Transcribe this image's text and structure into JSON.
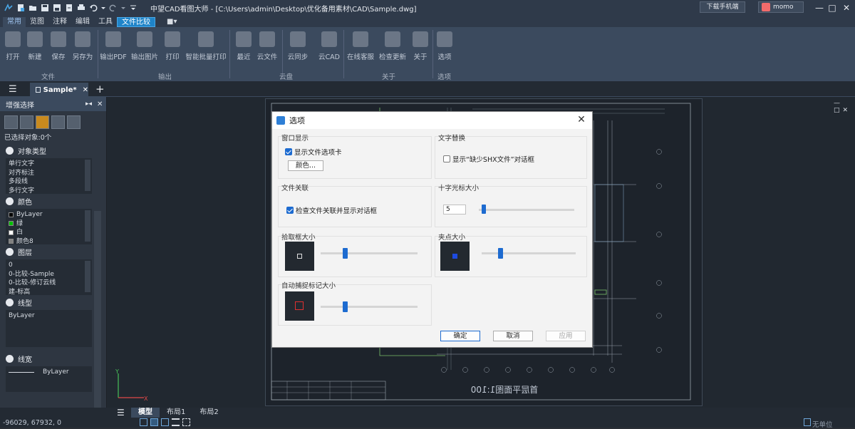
{
  "app": {
    "title": "中望CAD看图大师 - [C:\\Users\\admin\\Desktop\\优化备用素材\\CAD\\Sample.dwg]",
    "download_mobile": "下载手机端",
    "user": "momo"
  },
  "menu": {
    "items": [
      "常用",
      "览图",
      "注释",
      "编辑",
      "工具",
      "文件比较"
    ]
  },
  "ribbon": {
    "buttons": [
      "打开",
      "新建",
      "保存",
      "另存为",
      "输出PDF",
      "输出图片",
      "打印",
      "智能批量打印",
      "最近",
      "云文件",
      "云同步",
      "云CAD",
      "在线客服",
      "检查更新",
      "关于",
      "选项"
    ],
    "groups": [
      "文件",
      "输出",
      "云盘",
      "关于",
      "选项"
    ]
  },
  "tabs": {
    "doc": "Sample*"
  },
  "left_panel": {
    "title": "增强选择",
    "selected": "已选择对象:0个",
    "sections": {
      "object_type": {
        "title": "对象类型",
        "items": [
          "单行文字",
          "对齐标注",
          "多段线",
          "多行文字"
        ]
      },
      "color": {
        "title": "颜色",
        "items": [
          "ByLayer",
          "绿",
          "白",
          "颜色8"
        ],
        "swatches": [
          "#000000",
          "#00c000",
          "#ffffff",
          "#808080"
        ]
      },
      "layer": {
        "title": "图层",
        "items": [
          "0",
          "0-比较-Sample",
          "0-比较-修订云线",
          "建-标高"
        ]
      },
      "linetype": {
        "title": "线型",
        "items": [
          "ByLayer"
        ]
      },
      "lineweight": {
        "title": "线宽",
        "items": [
          "ByLayer"
        ]
      }
    }
  },
  "drawing": {
    "label": "首层平面图1:100"
  },
  "status": {
    "tabs": [
      "模型",
      "布局1",
      "布局2"
    ],
    "coords": "-96029, 67932, 0",
    "unit": "无单位"
  },
  "dialog": {
    "title": "选项",
    "window_display": {
      "title": "窗口显示",
      "show_tabs": "显示文件选项卡",
      "color_button": "颜色..."
    },
    "text_replace": {
      "title": "文字替换",
      "show_shx": "显示“缺少SHX文件”对话框"
    },
    "file_assoc": {
      "title": "文件关联",
      "check": "检查文件关联并显示对话框"
    },
    "crosshair": {
      "title": "十字光标大小",
      "value": "5",
      "level": 0.05
    },
    "pickbox": {
      "title": "拾取框大小",
      "level": 0.25
    },
    "grip": {
      "title": "夹点大小",
      "level": 0.2
    },
    "autosnap": {
      "title": "自动捕捉标记大小",
      "level": 0.25
    },
    "buttons": {
      "ok": "确定",
      "cancel": "取消",
      "apply": "应用"
    }
  }
}
